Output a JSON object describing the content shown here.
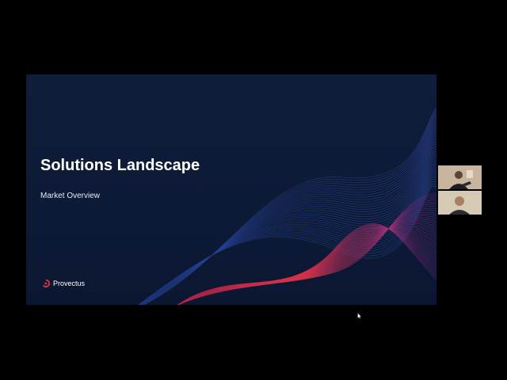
{
  "slide": {
    "title": "Solutions Landscape",
    "subtitle": "Market Overview",
    "brand_name": "Provectus",
    "brand_icon": "provectus-logo-icon",
    "background_color": "#0f1d3a",
    "wave_colors": [
      "#2c4aa8",
      "#e0324a"
    ]
  },
  "participants": [
    {
      "name": "",
      "icon": "participant-video"
    },
    {
      "name": "",
      "icon": "participant-video"
    }
  ],
  "pointer": {
    "icon": "mouse-cursor-icon"
  }
}
